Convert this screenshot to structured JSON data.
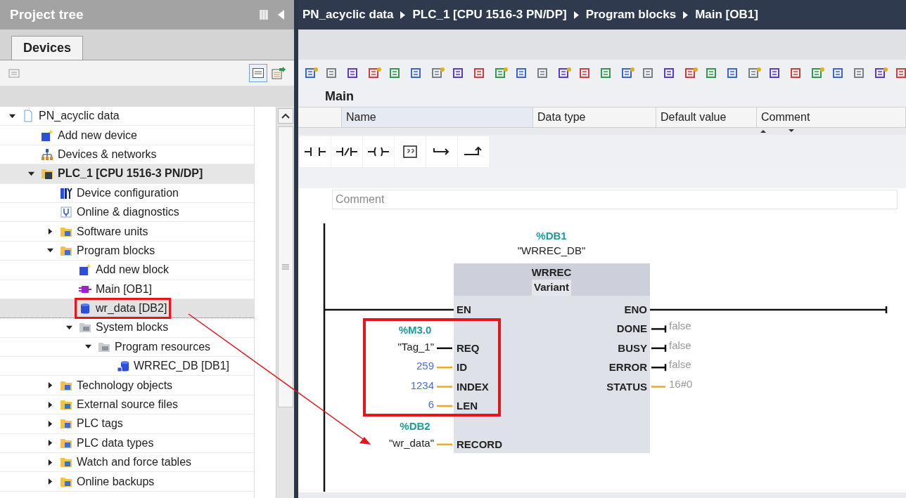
{
  "project_tree": {
    "title": "Project tree",
    "tabs": [
      {
        "label": "Devices",
        "selected": true
      }
    ],
    "items": [
      {
        "label": "PN_acyclic data",
        "kind": "project",
        "expanded": true,
        "selected": false,
        "children": [
          {
            "label": "Add new device",
            "kind": "add",
            "selected": false
          },
          {
            "label": "Devices & networks",
            "kind": "network",
            "selected": false
          },
          {
            "label": "PLC_1 [CPU 1516-3 PN/DP]",
            "kind": "plc",
            "expanded": true,
            "selected": false,
            "bold": true,
            "children": [
              {
                "label": "Device configuration",
                "kind": "config",
                "selected": false
              },
              {
                "label": "Online & diagnostics",
                "kind": "diagnostics",
                "selected": false
              },
              {
                "label": "Software units",
                "kind": "folder",
                "expanded": false,
                "selected": false
              },
              {
                "label": "Program blocks",
                "kind": "folder",
                "expanded": true,
                "selected": false,
                "children": [
                  {
                    "label": "Add new block",
                    "kind": "add",
                    "selected": false
                  },
                  {
                    "label": "Main [OB1]",
                    "kind": "ob",
                    "selected": false
                  },
                  {
                    "label": "wr_data [DB2]",
                    "kind": "db",
                    "selected": true,
                    "highlighted": true
                  },
                  {
                    "label": "System blocks",
                    "kind": "system_folder",
                    "expanded": true,
                    "selected": false,
                    "children": [
                      {
                        "label": "Program resources",
                        "kind": "system_folder",
                        "expanded": true,
                        "selected": false,
                        "children": [
                          {
                            "label": "WRREC_DB [DB1]",
                            "kind": "system_db",
                            "selected": false
                          }
                        ]
                      }
                    ]
                  }
                ]
              },
              {
                "label": "Technology objects",
                "kind": "folder",
                "expanded": false,
                "selected": false
              },
              {
                "label": "External source files",
                "kind": "folder",
                "expanded": false,
                "selected": false
              },
              {
                "label": "PLC tags",
                "kind": "folder",
                "expanded": false,
                "selected": false
              },
              {
                "label": "PLC data types",
                "kind": "folder",
                "expanded": false,
                "selected": false
              },
              {
                "label": "Watch and force tables",
                "kind": "folder",
                "expanded": false,
                "selected": false
              },
              {
                "label": "Online backups",
                "kind": "folder",
                "expanded": false,
                "selected": false
              }
            ]
          }
        ]
      }
    ]
  },
  "editor": {
    "breadcrumb": [
      "PN_acyclic data",
      "PLC_1 [CPU 1516-3 PN/DP]",
      "Program blocks",
      "Main [OB1]"
    ],
    "block_name": "Main",
    "columns": [
      "Name",
      "Data type",
      "Default value",
      "Comment"
    ],
    "comment_placeholder": "Comment",
    "network": {
      "instance_address": "%DB1",
      "instance_name": "\"WRREC_DB\"",
      "block": "WRREC",
      "block_type": "Variant",
      "inputs": [
        {
          "param": "EN",
          "kind": "power"
        },
        {
          "param": "REQ",
          "kind": "bool",
          "address": "%M3.0",
          "operand": "\"Tag_1\"",
          "highlighted": true
        },
        {
          "param": "ID",
          "kind": "constant",
          "operand": "259",
          "highlighted": true
        },
        {
          "param": "INDEX",
          "kind": "constant",
          "operand": "1234",
          "highlighted": true
        },
        {
          "param": "LEN",
          "kind": "constant",
          "operand": "6",
          "highlighted": true
        },
        {
          "param": "RECORD",
          "kind": "variant",
          "address": "%DB2",
          "operand": "\"wr_data\""
        }
      ],
      "outputs": [
        {
          "param": "ENO",
          "kind": "power"
        },
        {
          "param": "DONE",
          "kind": "bool",
          "value": "false"
        },
        {
          "param": "BUSY",
          "kind": "bool",
          "value": "false"
        },
        {
          "param": "ERROR",
          "kind": "bool",
          "value": "false"
        },
        {
          "param": "STATUS",
          "kind": "word",
          "value": "16#0"
        }
      ]
    }
  },
  "annotation": {
    "arrow": true
  }
}
